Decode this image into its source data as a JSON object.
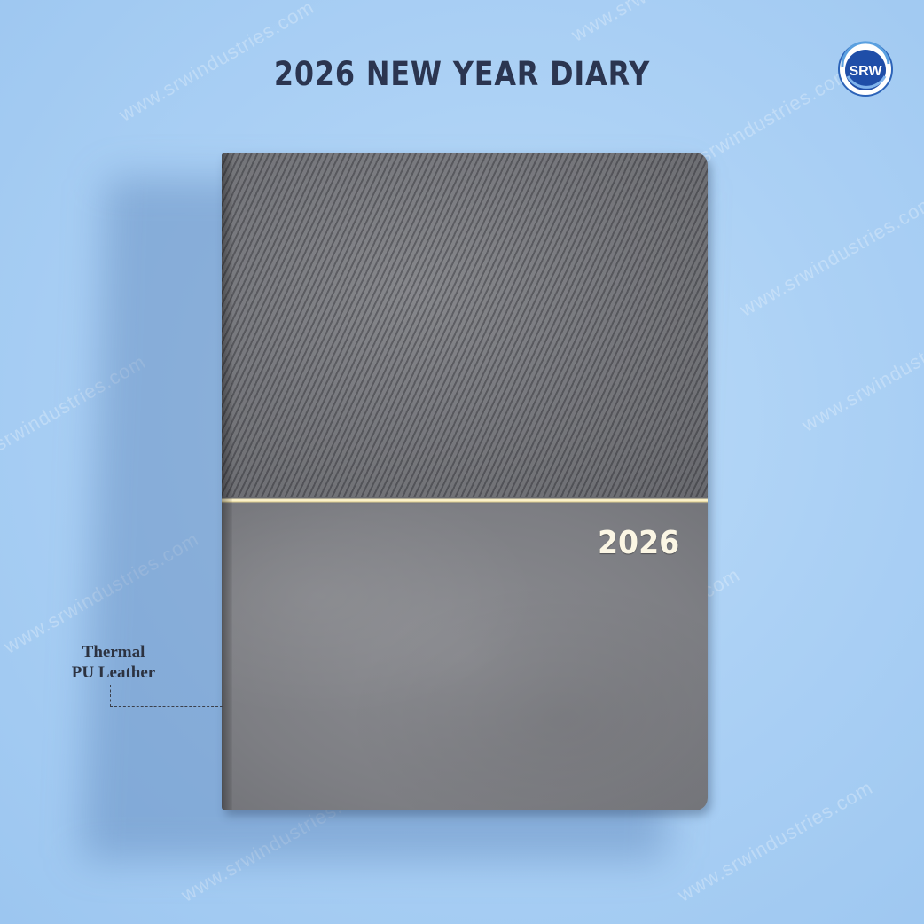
{
  "page": {
    "headline": "2026 NEW YEAR DIARY"
  },
  "logo": {
    "text": "SRW",
    "colors": {
      "ring": "#2c63b8",
      "fill": "#1f4ea8",
      "text": "#ffffff"
    }
  },
  "watermark": {
    "text": "www.srwindustries.com"
  },
  "product": {
    "cover_year": "2026",
    "colors": {
      "top_panel": "#6c6d72",
      "bottom_panel": "#7d7e83",
      "gold_band": "#efe3b4",
      "background": "#acd1f5"
    }
  },
  "callout": {
    "line1": "Thermal",
    "line2": "PU Leather"
  }
}
